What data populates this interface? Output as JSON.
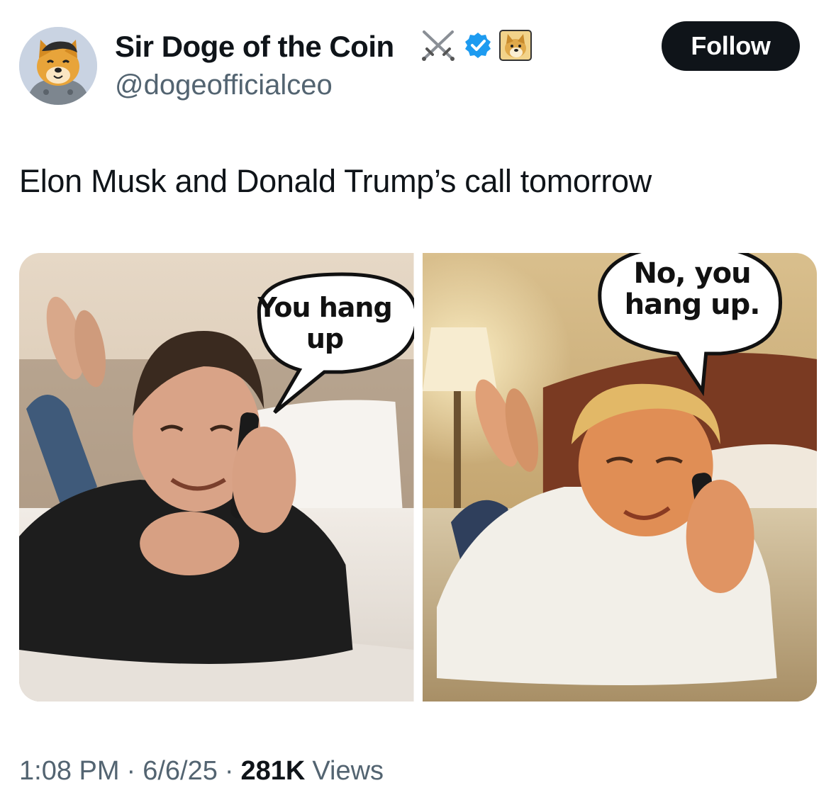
{
  "author": {
    "display_name": "Sir Doge of the Coin",
    "handle": "@dogeofficialceo",
    "icons": [
      "crossed-swords-icon",
      "verified-badge-icon",
      "doge-emoji-icon"
    ],
    "verified_color": "#1d9bf0"
  },
  "follow_button": {
    "label": "Follow",
    "background": "#0f1419"
  },
  "tweet": {
    "text": "Elon Musk and Donald Trump’s call tomorrow"
  },
  "media": {
    "left_panel": {
      "speech_bubble": "You hang up"
    },
    "right_panel": {
      "speech_bubble": "No, you hang up."
    }
  },
  "footer": {
    "time": "1:08 PM",
    "date": "6/6/25",
    "views_count": "281K",
    "views_label": "Views",
    "separator": "·"
  }
}
